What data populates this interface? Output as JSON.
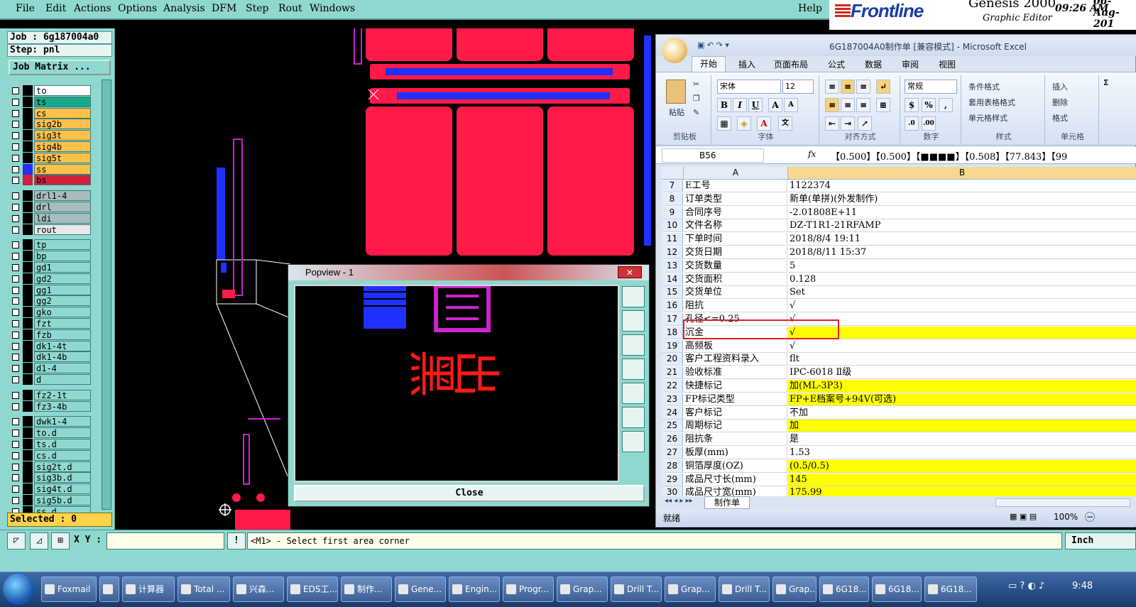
{
  "genesis": {
    "menu": [
      "File",
      "Edit",
      "Actions",
      "Options",
      "Analysis",
      "DFM",
      "Step",
      "Rout",
      "Windows"
    ],
    "help": "Help",
    "brand": "Frontline",
    "product": "Genesis 2000",
    "product_sub": "Graphic Editor",
    "date_partial": "06-Aug-201",
    "time": "09:26 AM",
    "job_label": "Job : 6g187004a0",
    "step_label": "Step: pnl",
    "job_matrix": "Job Matrix ...",
    "selected": "Selected : 0",
    "layers": [
      {
        "name": "to",
        "color": "#ffffff"
      },
      {
        "name": "ts",
        "color": "#1aa88a"
      },
      {
        "name": "cs",
        "color": "#ffc04a"
      },
      {
        "name": "sig2b",
        "color": "#ffc04a"
      },
      {
        "name": "sig3t",
        "color": "#ffc04a"
      },
      {
        "name": "sig4b",
        "color": "#ffc04a"
      },
      {
        "name": "sig5t",
        "color": "#ffc04a"
      },
      {
        "name": "ss",
        "color": "#ffc04a"
      },
      {
        "name": "bs",
        "color": "#d0203c"
      },
      {
        "name": "drl1-4",
        "color": "#a8bcc0"
      },
      {
        "name": "drl",
        "color": "#a8bcc0"
      },
      {
        "name": "ldi",
        "color": "#a8bcc0"
      },
      {
        "name": "rout",
        "color": "#e8e8e8"
      },
      {
        "name": "tp",
        "color": "#8fd8cf"
      },
      {
        "name": "bp",
        "color": "#8fd8cf"
      },
      {
        "name": "gd1",
        "color": "#8fd8cf"
      },
      {
        "name": "gd2",
        "color": "#8fd8cf"
      },
      {
        "name": "gg1",
        "color": "#8fd8cf"
      },
      {
        "name": "gg2",
        "color": "#8fd8cf"
      },
      {
        "name": "gko",
        "color": "#8fd8cf"
      },
      {
        "name": "fzt",
        "color": "#8fd8cf"
      },
      {
        "name": "fzb",
        "color": "#8fd8cf"
      },
      {
        "name": "dk1-4t",
        "color": "#8fd8cf"
      },
      {
        "name": "dk1-4b",
        "color": "#8fd8cf"
      },
      {
        "name": "d1-4",
        "color": "#8fd8cf"
      },
      {
        "name": "d",
        "color": "#8fd8cf"
      },
      {
        "name": "fz2-1t",
        "color": "#8fd8cf"
      },
      {
        "name": "fz3-4b",
        "color": "#8fd8cf"
      },
      {
        "name": "dwk1-4",
        "color": "#8fd8cf"
      },
      {
        "name": "to.d",
        "color": "#8fd8cf"
      },
      {
        "name": "ts.d",
        "color": "#8fd8cf"
      },
      {
        "name": "cs.d",
        "color": "#8fd8cf"
      },
      {
        "name": "sig2t.d",
        "color": "#8fd8cf"
      },
      {
        "name": "sig3b.d",
        "color": "#8fd8cf"
      },
      {
        "name": "sig4t.d",
        "color": "#8fd8cf"
      },
      {
        "name": "sig5b.d",
        "color": "#8fd8cf"
      },
      {
        "name": "ss.d",
        "color": "#8fd8cf"
      }
    ],
    "popview_title": "Popview - 1",
    "popview_close": "Close",
    "popview_text": "出黑",
    "xy_label": "X Y :",
    "message": "<M1> - Select first area corner",
    "unit": "Inch"
  },
  "excel": {
    "title": "6G187004A0制作单  [兼容模式] - Microsoft Excel",
    "tabs": [
      "开始",
      "插入",
      "页面布局",
      "公式",
      "数据",
      "审阅",
      "视图"
    ],
    "active_tab": "开始",
    "groups": [
      "剪贴板",
      "字体",
      "对齐方式",
      "数字",
      "样式",
      "单元格"
    ],
    "paste": "粘贴",
    "font_name": "宋体",
    "font_size": "12",
    "number_format": "常规",
    "style_buttons": [
      "条件格式",
      "套用表格格式",
      "单元格样式"
    ],
    "cell_buttons": [
      "插入",
      "删除",
      "格式"
    ],
    "name_box": "B56",
    "formula": "【0.500】【0.500】【■■■■】【0.508】【77.843】【99",
    "col_a": "A",
    "col_b": "B",
    "rows": [
      {
        "n": "7",
        "a": "E工号",
        "b": "1122374",
        "hl": false
      },
      {
        "n": "8",
        "a": "订单类型",
        "b": "新单(单拼)(外发制作)",
        "hl": false
      },
      {
        "n": "9",
        "a": "合同序号",
        "b": "-2.01808E+11",
        "hl": false
      },
      {
        "n": "10",
        "a": "文件名称",
        "b": "DZ-T1R1-21RFAMP",
        "hl": false
      },
      {
        "n": "11",
        "a": "下单时间",
        "b": "2018/8/4 19:11",
        "hl": false
      },
      {
        "n": "12",
        "a": "交货日期",
        "b": "2018/8/11 15:37",
        "hl": false
      },
      {
        "n": "13",
        "a": "交货数量",
        "b": "5",
        "hl": false
      },
      {
        "n": "14",
        "a": "交货面积",
        "b": "0.128",
        "hl": false
      },
      {
        "n": "15",
        "a": "交货单位",
        "b": "Set",
        "hl": false
      },
      {
        "n": "16",
        "a": "阻抗",
        "b": "√",
        "hl": false
      },
      {
        "n": "17",
        "a": "孔径<=0.25",
        "b": "√",
        "hl": false
      },
      {
        "n": "18",
        "a": "沉金",
        "b": "√",
        "hl": true
      },
      {
        "n": "19",
        "a": "高频板",
        "b": "√",
        "hl": false
      },
      {
        "n": "20",
        "a": "客户工程资料录入",
        "b": "flt",
        "hl": false
      },
      {
        "n": "21",
        "a": "验收标准",
        "b": "IPC-6018 Ⅱ级",
        "hl": false
      },
      {
        "n": "22",
        "a": "快捷标记",
        "b": "加(ML-3P3)",
        "hl": true
      },
      {
        "n": "23",
        "a": "FP标记类型",
        "b": "FP+E档案号+94V(可选)",
        "hl": true
      },
      {
        "n": "24",
        "a": "客户标记",
        "b": "不加",
        "hl": false
      },
      {
        "n": "25",
        "a": "周期标记",
        "b": "加",
        "hl": true
      },
      {
        "n": "26",
        "a": "阻抗条",
        "b": "是",
        "hl": false
      },
      {
        "n": "27",
        "a": "板厚(mm)",
        "b": "1.53",
        "hl": false
      },
      {
        "n": "28",
        "a": "铜箔厚度(OZ)",
        "b": "(0.5/0.5)",
        "hl": true
      },
      {
        "n": "29",
        "a": "成品尺寸长(mm)",
        "b": "145",
        "hl": true
      },
      {
        "n": "30",
        "a": "成品尺寸宽(mm)",
        "b": "175.99",
        "hl": true
      }
    ],
    "sheet_tab": "制作单",
    "status": "就绪",
    "zoom": "100%"
  },
  "taskbar": {
    "items": [
      "Foxmail",
      "",
      "计算器",
      "Total ...",
      "兴森...",
      "EDS工...",
      "制作...",
      "Gene...",
      "Engin...",
      "Progr...",
      "Grap...",
      "Drill T...",
      "Grap...",
      "Drill T...",
      "Grap...",
      "6G18...",
      "6G18...",
      "6G18..."
    ],
    "clock": "9:48"
  }
}
